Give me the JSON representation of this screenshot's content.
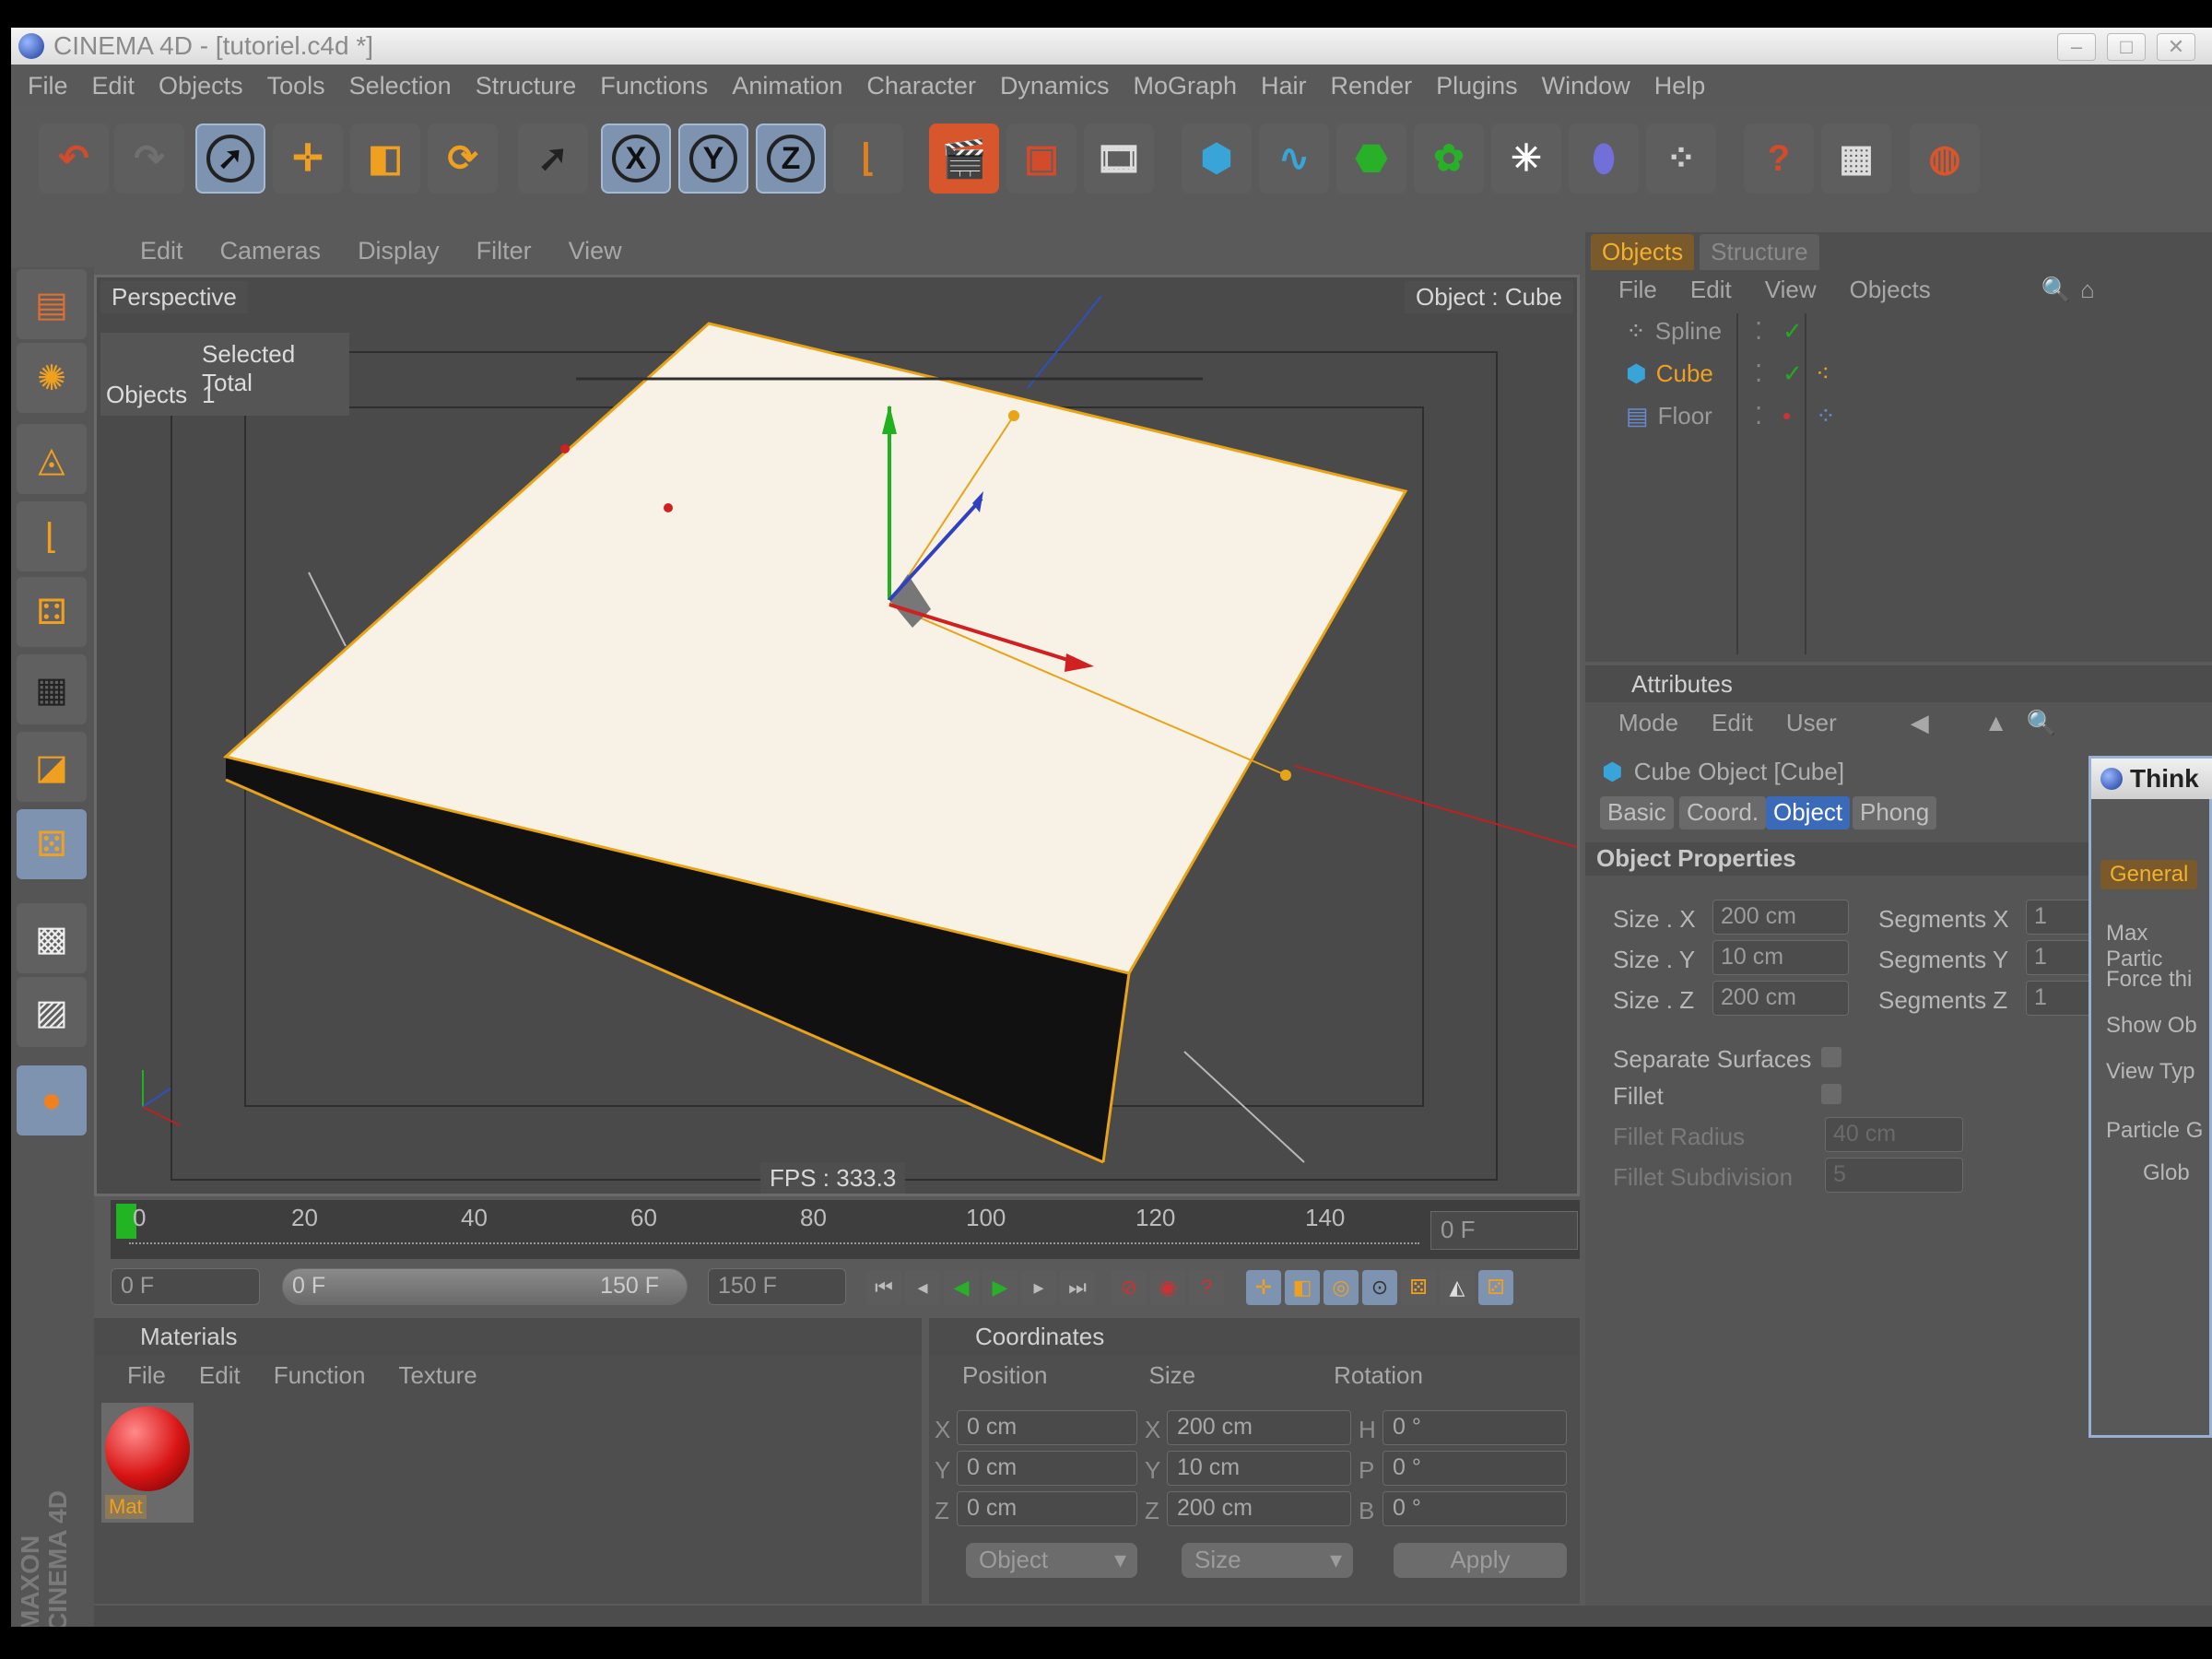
{
  "window": {
    "title": "CINEMA 4D - [tutoriel.c4d *]"
  },
  "menu": [
    "File",
    "Edit",
    "Objects",
    "Tools",
    "Selection",
    "Structure",
    "Functions",
    "Animation",
    "Character",
    "Dynamics",
    "MoGraph",
    "Hair",
    "Render",
    "Plugins",
    "Window",
    "Help"
  ],
  "toolbar": {
    "axis_x": "X",
    "axis_y": "Y",
    "axis_z": "Z"
  },
  "viewport": {
    "menu": [
      "Edit",
      "Cameras",
      "Display",
      "Filter",
      "View"
    ],
    "mode_label": "Perspective",
    "object_label": "Object : Cube",
    "hud_header": "Selected Total",
    "hud_objects_label": "Objects",
    "hud_objects_value": "1",
    "fps": "FPS : 333.3"
  },
  "timeline": {
    "ticks": [
      "0",
      "20",
      "40",
      "60",
      "80",
      "100",
      "120",
      "140"
    ],
    "current_frame": "0 F",
    "start": "0 F",
    "slider_left": "0 F",
    "slider_right": "150 F",
    "end": "150 F",
    "progress": 0
  },
  "object_manager": {
    "tabs": [
      "Objects",
      "Structure"
    ],
    "menu": [
      "File",
      "Edit",
      "View",
      "Objects"
    ],
    "objects": [
      {
        "name": "Spline",
        "selected": false
      },
      {
        "name": "Cube",
        "selected": true
      },
      {
        "name": "Floor",
        "selected": false
      }
    ]
  },
  "attributes": {
    "header": "Attributes",
    "menu": [
      "Mode",
      "Edit",
      "User"
    ],
    "object_title": "Cube Object [Cube]",
    "tabs": [
      "Basic",
      "Coord.",
      "Object",
      "Phong"
    ],
    "active_tab": "Object",
    "section": "Object Properties",
    "size_labels": [
      "Size . X",
      "Size . Y",
      "Size . Z"
    ],
    "size_values": [
      "200 cm",
      "10 cm",
      "200 cm"
    ],
    "segment_labels": [
      "Segments X",
      "Segments Y",
      "Segments Z"
    ],
    "segment_values": [
      "1",
      "1",
      "1"
    ],
    "separate_surfaces": "Separate Surfaces",
    "fillet": "Fillet",
    "fillet_radius_label": "Fillet Radius",
    "fillet_radius_value": "40 cm",
    "fillet_subdivision_label": "Fillet Subdivision",
    "fillet_subdivision_value": "5"
  },
  "materials": {
    "header": "Materials",
    "menu": [
      "File",
      "Edit",
      "Function",
      "Texture"
    ],
    "items": [
      {
        "name": "Mat",
        "color": "#d81414"
      }
    ]
  },
  "coordinates": {
    "header": "Coordinates",
    "columns": [
      "Position",
      "Size",
      "Rotation"
    ],
    "rows": [
      {
        "axis": "X",
        "pos": "0 cm",
        "size_axis": "X",
        "size": "200 cm",
        "rot_axis": "H",
        "rot": "0 °"
      },
      {
        "axis": "Y",
        "pos": "0 cm",
        "size_axis": "Y",
        "size": "10 cm",
        "rot_axis": "P",
        "rot": "0 °"
      },
      {
        "axis": "Z",
        "pos": "0 cm",
        "size_axis": "Z",
        "size": "200 cm",
        "rot_axis": "B",
        "rot": "0 °"
      }
    ],
    "mode_dropdown": "Object",
    "size_dropdown": "Size",
    "apply_label": "Apply"
  },
  "thinking_window": {
    "title": "Think",
    "tab": "General",
    "rows": [
      "Max Partic",
      "Force thi",
      "Show Ob",
      "View Typ",
      "Particle G",
      "Glob"
    ]
  },
  "brand": {
    "line1": "MAXON",
    "line2": "CINEMA 4D"
  },
  "colors": {
    "accent_select": "#7d93b0",
    "highlight_orange": "#e8a317",
    "selected_tab": "#3a6ab8"
  }
}
